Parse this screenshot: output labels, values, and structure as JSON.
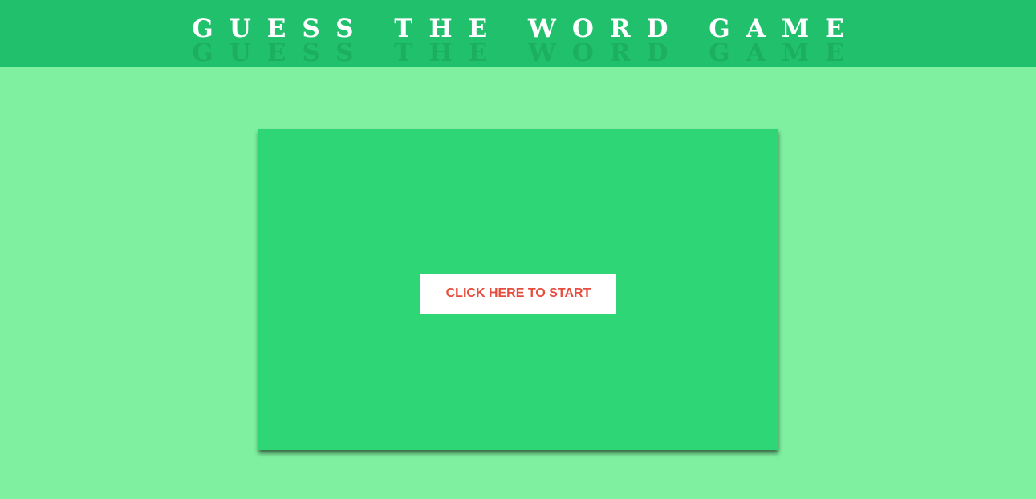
{
  "header": {
    "title": "GUESS THE WORD GAME"
  },
  "game": {
    "start_button_label": "CLICK HERE TO START"
  },
  "colors": {
    "page_background": "#7ef09f",
    "header_background": "#21c06c",
    "panel_background": "#2ed676",
    "button_background": "#ffffff",
    "button_text": "#e74c3c",
    "title_text": "#ffffff"
  }
}
